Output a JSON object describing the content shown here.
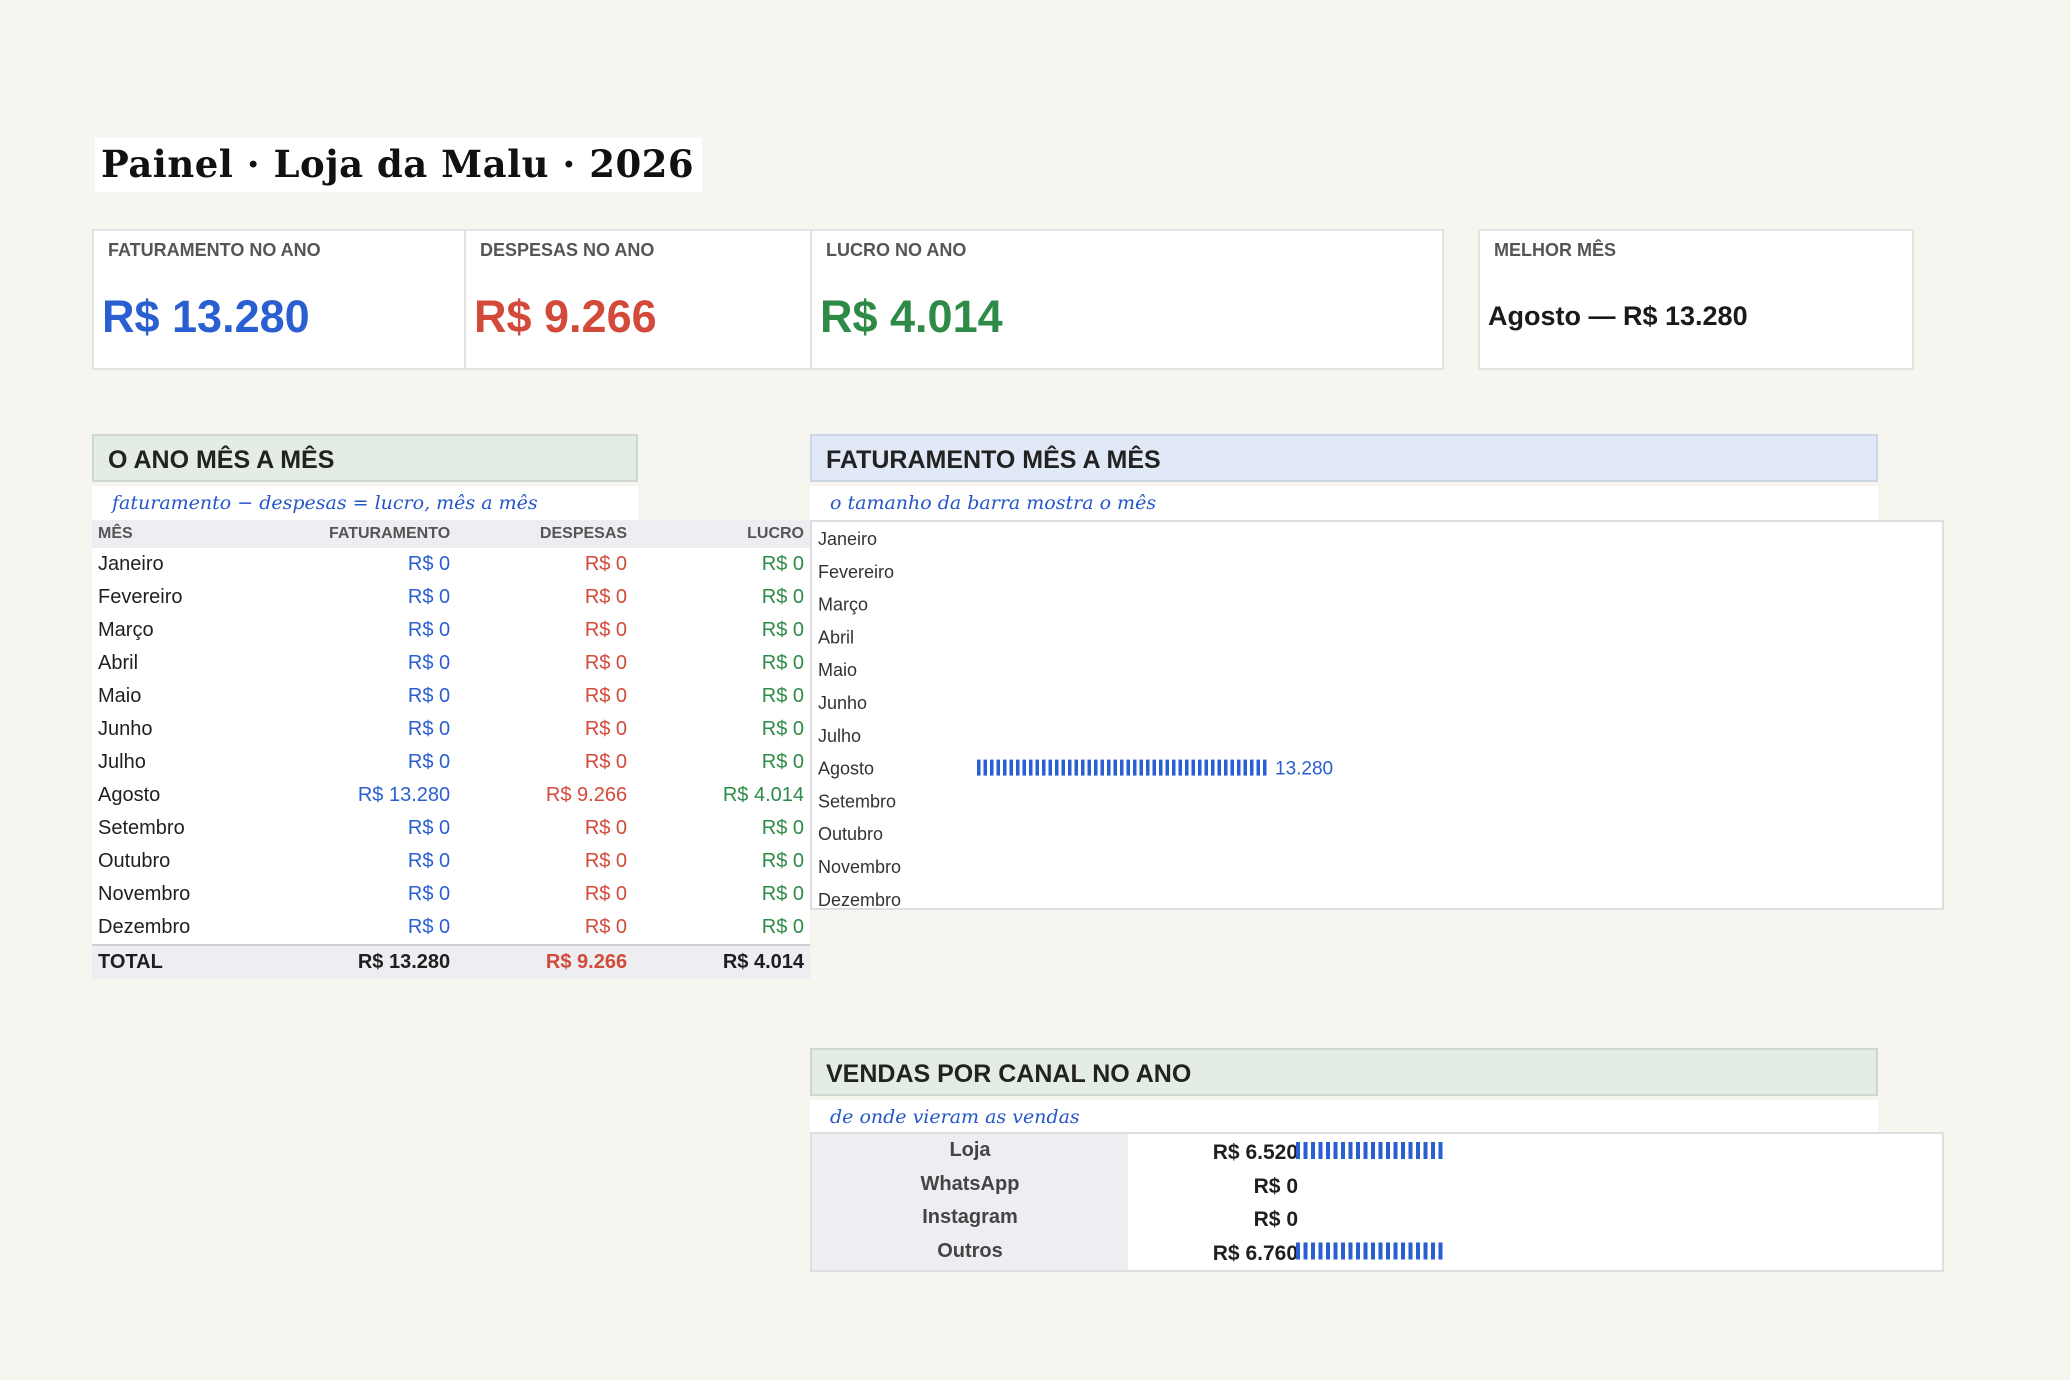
{
  "title": "Painel · Loja da Malu · 2026",
  "kpis": {
    "faturamento": {
      "label": "FATURAMENTO NO ANO",
      "value": "R$ 13.280",
      "color": "#2a5fd1"
    },
    "despesas": {
      "label": "DESPESAS NO ANO",
      "value": "R$ 9.266",
      "color": "#d3493a"
    },
    "lucro": {
      "label": "LUCRO NO ANO",
      "value": "R$ 4.014",
      "color": "#2e8b47"
    },
    "melhor": {
      "label": "MELHOR MÊS",
      "value": "Agosto — R$ 13.280"
    }
  },
  "monthly": {
    "header": "O ANO MÊS A MÊS",
    "subtitle": "faturamento − despesas = lucro, mês a mês",
    "columns": [
      "MÊS",
      "FATURAMENTO",
      "DESPESAS",
      "LUCRO"
    ],
    "rows": [
      [
        "Janeiro",
        "R$ 0",
        "R$ 0",
        "R$ 0"
      ],
      [
        "Fevereiro",
        "R$ 0",
        "R$ 0",
        "R$ 0"
      ],
      [
        "Março",
        "R$ 0",
        "R$ 0",
        "R$ 0"
      ],
      [
        "Abril",
        "R$ 0",
        "R$ 0",
        "R$ 0"
      ],
      [
        "Maio",
        "R$ 0",
        "R$ 0",
        "R$ 0"
      ],
      [
        "Junho",
        "R$ 0",
        "R$ 0",
        "R$ 0"
      ],
      [
        "Julho",
        "R$ 0",
        "R$ 0",
        "R$ 0"
      ],
      [
        "Agosto",
        "R$ 13.280",
        "R$ 9.266",
        "R$ 4.014"
      ],
      [
        "Setembro",
        "R$ 0",
        "R$ 0",
        "R$ 0"
      ],
      [
        "Outubro",
        "R$ 0",
        "R$ 0",
        "R$ 0"
      ],
      [
        "Novembro",
        "R$ 0",
        "R$ 0",
        "R$ 0"
      ],
      [
        "Dezembro",
        "R$ 0",
        "R$ 0",
        "R$ 0"
      ]
    ],
    "total": [
      "TOTAL",
      "R$ 13.280",
      "R$ 9.266",
      "R$ 4.014"
    ]
  },
  "revenue_section": {
    "header": "FATURAMENTO MÊS A MÊS",
    "subtitle": "o tamanho da barra mostra o mês"
  },
  "channels_section": {
    "header": "VENDAS POR CANAL NO ANO",
    "subtitle": "de onde vieram as vendas",
    "rows": [
      {
        "label": "Loja",
        "value_text": "R$ 6.520",
        "value": 6520
      },
      {
        "label": "WhatsApp",
        "value_text": "R$ 0",
        "value": 0
      },
      {
        "label": "Instagram",
        "value_text": "R$ 0",
        "value": 0
      },
      {
        "label": "Outros",
        "value_text": "R$ 6.760",
        "value": 6760
      }
    ]
  },
  "colors": {
    "bar": "#2a5fd1",
    "head_green": "#e4ede4",
    "head_blue": "#e2e9f6"
  },
  "chart_data": {
    "type": "bar",
    "orientation": "horizontal",
    "categories": [
      "Janeiro",
      "Fevereiro",
      "Março",
      "Abril",
      "Maio",
      "Junho",
      "Julho",
      "Agosto",
      "Setembro",
      "Outubro",
      "Novembro",
      "Dezembro"
    ],
    "values": [
      0,
      0,
      0,
      0,
      0,
      0,
      0,
      13280,
      0,
      0,
      0,
      0
    ],
    "value_labels": [
      "",
      "",
      "",
      "",
      "",
      "",
      "",
      "13.280",
      "",
      "",
      "",
      ""
    ]
  }
}
